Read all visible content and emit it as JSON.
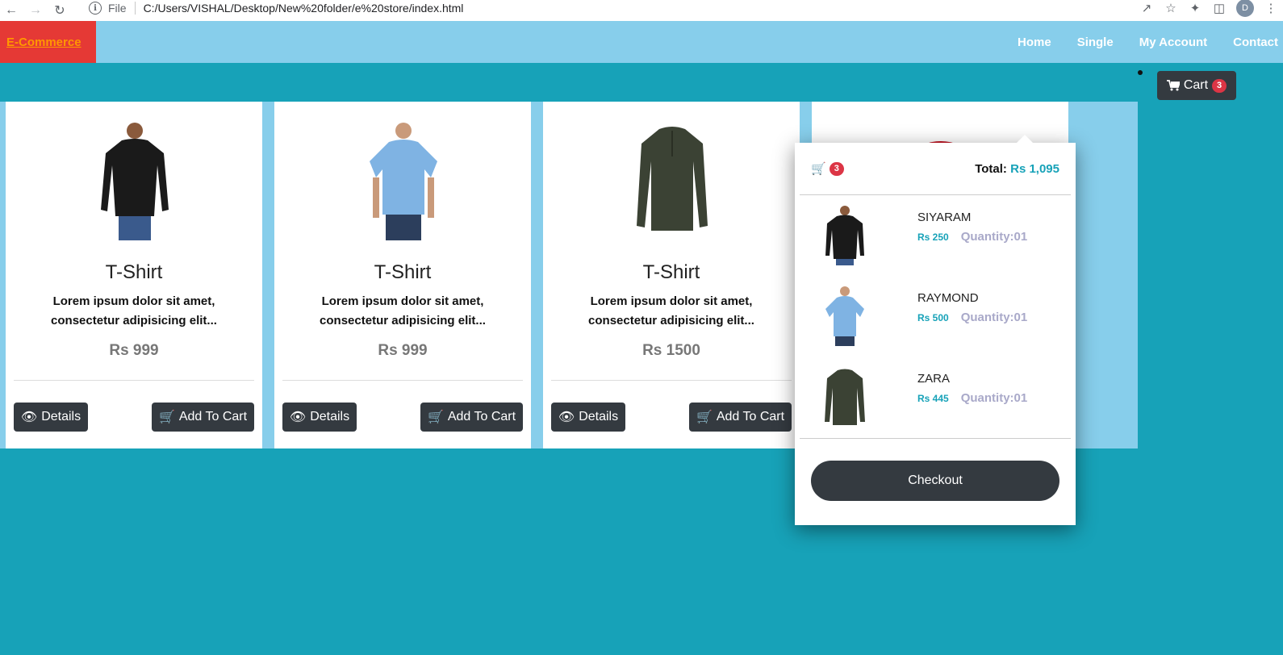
{
  "browser": {
    "file_label": "File",
    "url": "C:/Users/VISHAL/Desktop/New%20folder/e%20store/index.html",
    "profile_initial": "D"
  },
  "navbar": {
    "brand": "E-Commerce",
    "links": [
      "Home",
      "Single",
      "My Account",
      "Contact"
    ]
  },
  "cart_button": {
    "label": "Cart",
    "count": "3"
  },
  "products": [
    {
      "title": "T-Shirt",
      "desc": "Lorem ipsum dolor sit amet, consectetur adipisicing elit...",
      "price": "Rs 999",
      "details_label": "Details",
      "add_label": "Add To Cart",
      "color": "#1a1a1a",
      "type": "long-sleeve"
    },
    {
      "title": "T-Shirt",
      "desc": "Lorem ipsum dolor sit amet, consectetur adipisicing elit...",
      "price": "Rs 999",
      "details_label": "Details",
      "add_label": "Add To Cart",
      "color": "#7fb3e3",
      "type": "short-sleeve"
    },
    {
      "title": "T-Shirt",
      "desc": "Lorem ipsum dolor sit amet, consectetur adipisicing elit...",
      "price": "Rs 1500",
      "details_label": "Details",
      "add_label": "Add To Cart",
      "color": "#3b4234",
      "type": "henley"
    },
    {
      "color": "#c0111f"
    }
  ],
  "cart_dropdown": {
    "count": "3",
    "total_label": "Total:",
    "total_value": "Rs 1,095",
    "items": [
      {
        "name": "SIYARAM",
        "price": "Rs 250",
        "qty": "Quantity:01",
        "color": "#1a1a1a"
      },
      {
        "name": "RAYMOND",
        "price": "Rs 500",
        "qty": "Quantity:01",
        "color": "#7fb3e3"
      },
      {
        "name": "ZARA",
        "price": "Rs 445",
        "qty": "Quantity:01",
        "color": "#3b4234"
      }
    ],
    "checkout_label": "Checkout"
  }
}
